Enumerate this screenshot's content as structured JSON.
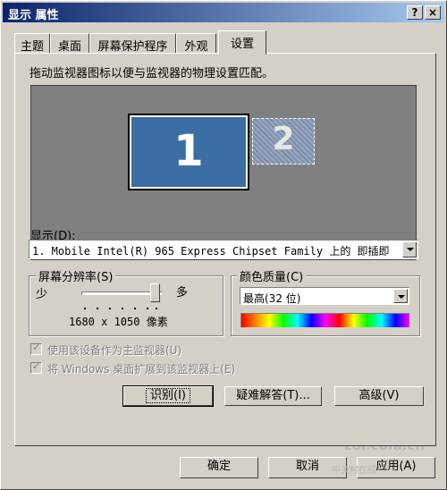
{
  "window": {
    "title": "显示 属性",
    "help_btn": "?",
    "close_btn": "×"
  },
  "tabs": [
    "主题",
    "桌面",
    "屏幕保护程序",
    "外观",
    "设置"
  ],
  "active_tab": "设置",
  "settings": {
    "description": "拖动监视器图标以便与监视器的物理设置匹配。",
    "monitors": [
      {
        "label": "1",
        "state": "primary"
      },
      {
        "label": "2",
        "state": "inactive"
      }
    ],
    "display_label": "显示(D):",
    "display_value": "1. Mobile Intel(R) 965 Express Chipset Family 上的 即插即",
    "resolution": {
      "title": "屏幕分辨率(S)",
      "less": "少",
      "more": "多",
      "value": "1680 x 1050 像素",
      "slider_position": 1.0
    },
    "color": {
      "title": "颜色质量(C)",
      "value": "最高(32 位)"
    },
    "checkbox_primary": "使用该设备作为主监视器(U)",
    "checkbox_extend": "将 Windows 桌面扩展到该监视器上(E)",
    "buttons": {
      "identify": "识别(I)",
      "troubleshoot": "疑难解答(T)...",
      "advanced": "高级(V)"
    }
  },
  "footer": {
    "ok": "确定",
    "cancel": "取消",
    "apply": "应用(A)"
  },
  "watermark": {
    "logo": "zol.com.cn",
    "sub": "中关村在线"
  }
}
